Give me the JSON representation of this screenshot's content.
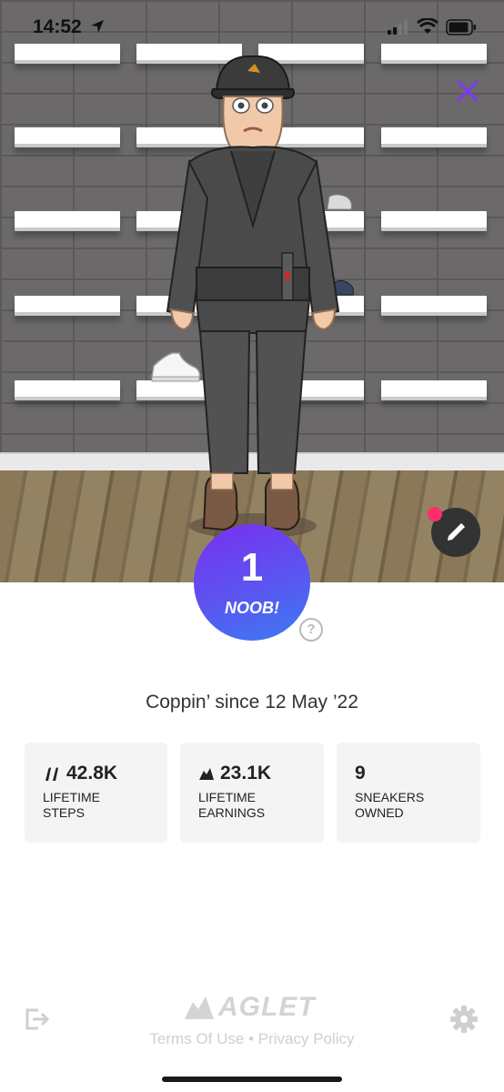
{
  "status_bar": {
    "time": "14:52"
  },
  "level": {
    "number": "1",
    "name": "NOOB!"
  },
  "help_icon": "?",
  "member_since": "Coppin’ since 12 May ’22",
  "stats": [
    {
      "value": "42.8K",
      "label_line1": "LIFETIME",
      "label_line2": "STEPS",
      "icon": "footsteps-icon"
    },
    {
      "value": "23.1K",
      "label_line1": "LIFETIME",
      "label_line2": "EARNINGS",
      "icon": "aglet-coin-icon"
    },
    {
      "value": "9",
      "label_line1": "SNEAKERS",
      "label_line2": "OWNED",
      "icon": ""
    }
  ],
  "footer": {
    "logo_text": "AGLET",
    "terms": "Terms Of Use",
    "separator": "•",
    "privacy": "Privacy Policy"
  },
  "colors": {
    "accent_purple": "#7a2ff0",
    "accent_blue": "#3c7cf3",
    "close_icon": "#7b3fe4",
    "notification_dot": "#ff2d6b"
  }
}
